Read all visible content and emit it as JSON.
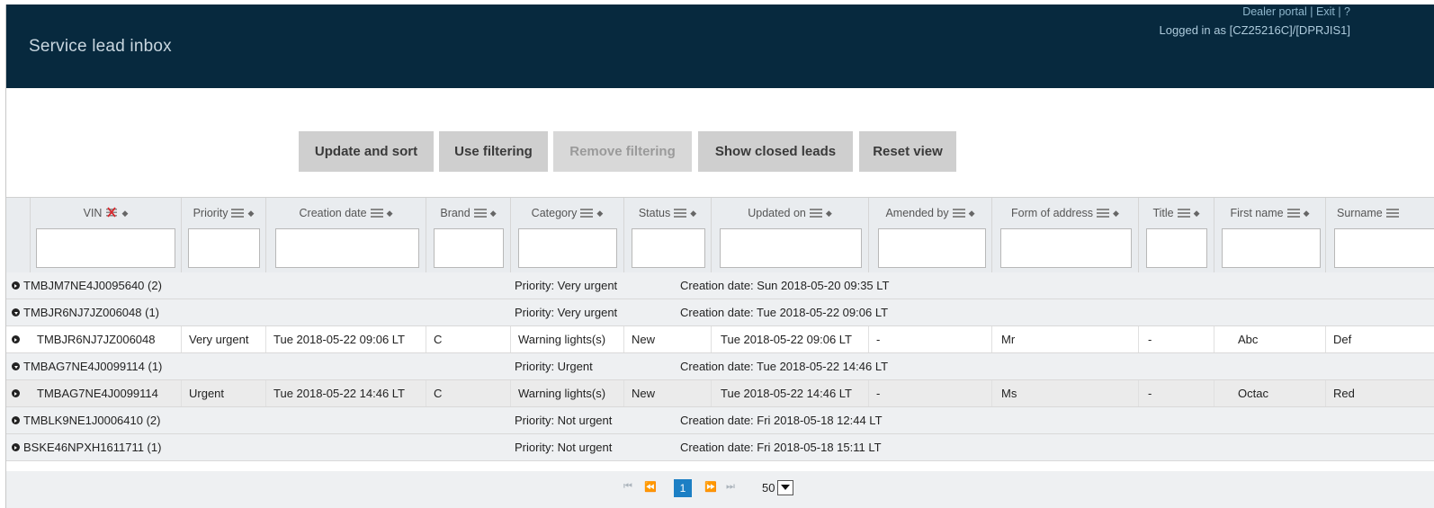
{
  "header": {
    "title": "Service lead inbox",
    "links": {
      "dealer_portal": "Dealer portal",
      "exit": "Exit",
      "help": "?"
    },
    "logged_in": "Logged in as [CZ25216C]/[DPRJIS1]"
  },
  "toolbar": {
    "update_sort": "Update and sort",
    "use_filtering": "Use filtering",
    "remove_filtering": "Remove filtering",
    "show_closed": "Show closed leads",
    "reset_view": "Reset view"
  },
  "columns": {
    "vin": "VIN",
    "priority": "Priority",
    "creation_date": "Creation date",
    "brand": "Brand",
    "category": "Category",
    "status": "Status",
    "updated_on": "Updated on",
    "amended_by": "Amended by",
    "form_of_address": "Form of address",
    "title": "Title",
    "first_name": "First name",
    "surname": "Surname"
  },
  "groups": [
    {
      "vin": "TMBJM7NE4J0095640 (2)",
      "priority": "Priority: Very urgent",
      "created": "Creation date: Sun 2018-05-20 09:35 LT"
    },
    {
      "vin": "TMBJR6NJ7JZ006048 (1)",
      "priority": "Priority: Very urgent",
      "created": "Creation date: Tue 2018-05-22 09:06 LT"
    },
    {
      "vin": "TMBAG7NE4J0099114 (1)",
      "priority": "Priority: Urgent",
      "created": "Creation date: Tue 2018-05-22 14:46 LT"
    },
    {
      "vin": "TMBLK9NE1J0006410 (2)",
      "priority": "Priority: Not urgent",
      "created": "Creation date: Fri 2018-05-18 12:44 LT"
    },
    {
      "vin": "BSKE46NPXH1611711 (1)",
      "priority": "Priority: Not urgent",
      "created": "Creation date: Fri 2018-05-18 15:11 LT"
    }
  ],
  "rows": [
    {
      "vin": "TMBJR6NJ7JZ006048",
      "priority": "Very urgent",
      "creation_date": "Tue 2018-05-22 09:06 LT",
      "brand": "C",
      "category": "Warning lights(s)",
      "status": "New",
      "updated_on": "Tue 2018-05-22 09:06 LT",
      "amended_by": "-",
      "form_of_address": "Mr",
      "title": "-",
      "first_name": "Abc",
      "surname": "Def"
    },
    {
      "vin": "TMBAG7NE4J0099114",
      "priority": "Urgent",
      "creation_date": "Tue 2018-05-22 14:46 LT",
      "brand": "C",
      "category": "Warning lights(s)",
      "status": "New",
      "updated_on": "Tue 2018-05-22 14:46 LT",
      "amended_by": "-",
      "form_of_address": "Ms",
      "title": "-",
      "first_name": "Octac",
      "surname": "Red"
    }
  ],
  "pager": {
    "current_page": "1",
    "page_size": "50"
  },
  "colors": {
    "header_bg": "#07293e",
    "button_bg": "#cfcfcf",
    "active_page": "#1c7fc4",
    "filter_x": "#d9262b"
  }
}
